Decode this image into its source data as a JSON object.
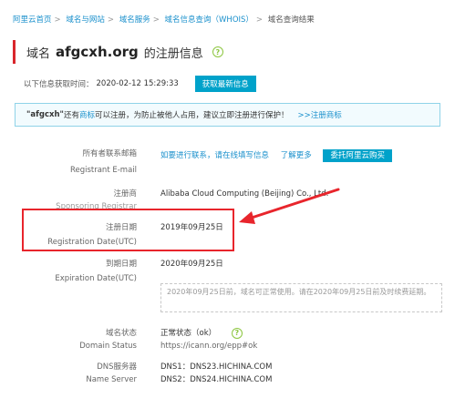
{
  "breadcrumb": {
    "items": [
      "阿里云首页",
      "域名与网站",
      "域名服务",
      "域名信息查询（WHOIS）"
    ],
    "current": "域名查询结果"
  },
  "title": {
    "prefix": "域名",
    "domain": "afgcxh.org",
    "suffix": "的注册信息"
  },
  "fetch": {
    "label": "以下信息获取时间：",
    "timestamp": "2020-02-12 15:29:33",
    "button": "获取最新信息"
  },
  "notice": {
    "name": "\"afgcxh\"",
    "text1": "还有",
    "link": "商标",
    "text2": "可以注册，为防止被他人占用，建议立即注册进行保护！",
    "cta": ">>注册商标"
  },
  "registrant_email": {
    "label_cn": "所有者联系邮箱",
    "label_en": "Registrant E-mail",
    "link": "如要进行联系，请在线填写信息",
    "more": "了解更多",
    "button": "委托阿里云购买"
  },
  "registrar": {
    "label_cn": "注册商",
    "label_en": "Sponsoring Registrar",
    "value": "Alibaba Cloud Computing (Beijing) Co., Ltd."
  },
  "registration_date": {
    "label_cn": "注册日期",
    "label_en": "Registration Date(UTC)",
    "value": "2019年09月25日"
  },
  "expiration_date": {
    "label_cn": "到期日期",
    "label_en": "Expiration Date(UTC)",
    "value": "2020年09月25日",
    "note": "2020年09月25日前，域名可正常使用。请在2020年09月25日前及时续费延期。"
  },
  "domain_status": {
    "label_cn": "域名状态",
    "label_en": "Domain Status",
    "value": "正常状态（ok）",
    "url": "https://icann.org/epp#ok"
  },
  "name_server": {
    "label_cn": "DNS服务器",
    "label_en": "Name Server",
    "dns1": "DNS1：DNS23.HICHINA.COM",
    "dns2": "DNS2：DNS24.HICHINA.COM"
  },
  "colors": {
    "accent": "#00a2ca",
    "link": "#1a90cc",
    "highlight": "#e8252c",
    "help_icon": "#8cc63f"
  },
  "icons": {
    "help": "question-circle-icon"
  }
}
